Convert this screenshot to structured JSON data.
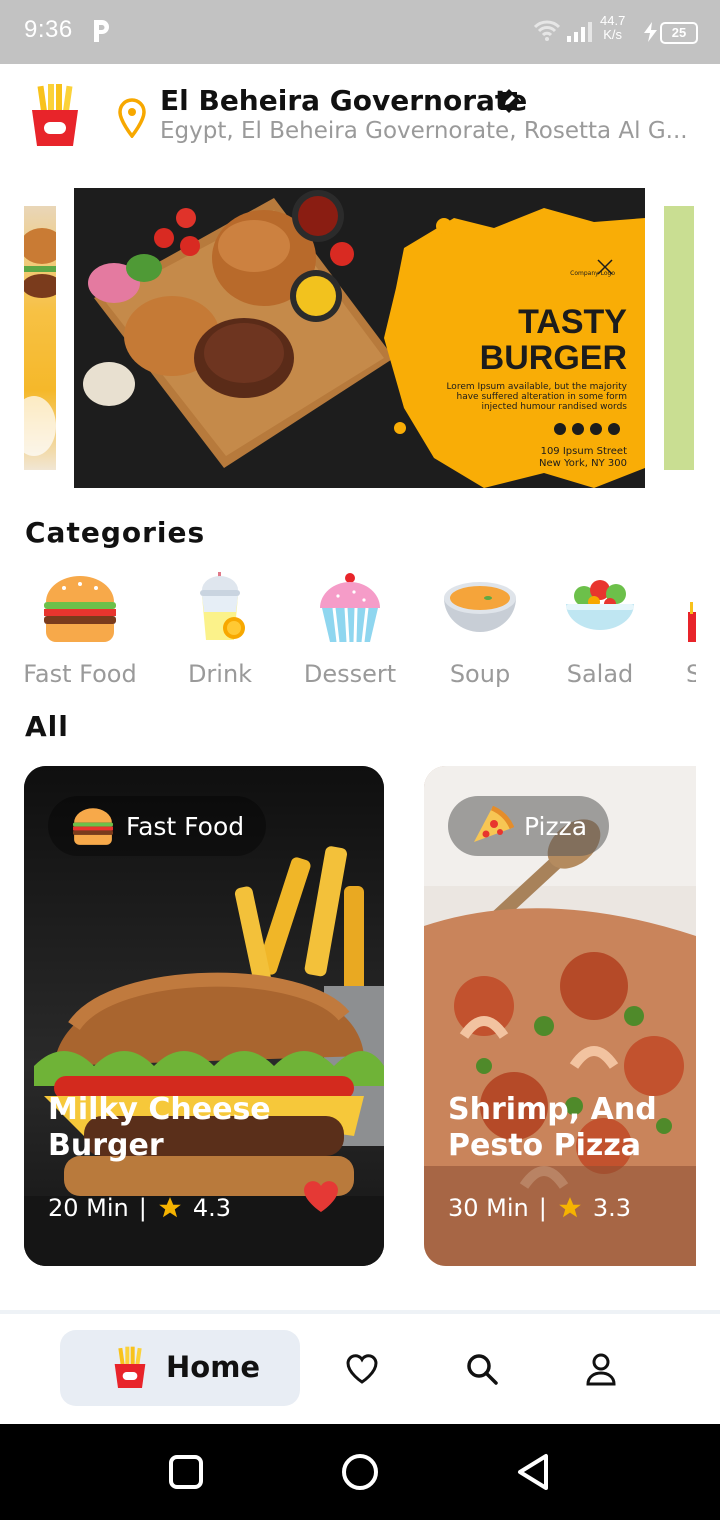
{
  "status_bar": {
    "time": "9:36",
    "net_speed": "44.7",
    "net_unit": "K/s",
    "battery": "25"
  },
  "header": {
    "location_title": "El Beheira Governorate",
    "location_subtitle": "Egypt, El Beheira Governorate, Rosetta Al G..."
  },
  "banner": {
    "headline_line1": "TASTY",
    "headline_line2": "BURGER",
    "company_logo": "Company Logo",
    "body_text": "Lorem Ipsum available, but the majority have suffered alteration in some form injected humour randised words",
    "address_line1": "109 Ipsum Street",
    "address_line2": "New York, NY 300"
  },
  "categories": {
    "title": "Categories",
    "items": [
      {
        "label": "Fast Food",
        "icon": "burger-icon"
      },
      {
        "label": "Drink",
        "icon": "drink-icon"
      },
      {
        "label": "Dessert",
        "icon": "cupcake-icon"
      },
      {
        "label": "Soup",
        "icon": "soup-icon"
      },
      {
        "label": "Salad",
        "icon": "salad-icon"
      },
      {
        "label": "S",
        "icon": "fries-icon"
      }
    ]
  },
  "all": {
    "title": "All",
    "cards": [
      {
        "tag": "Fast Food",
        "title": "Milky Cheese Burger",
        "time": "20 Min",
        "separator": "|",
        "rating": "4.3",
        "favorited": true
      },
      {
        "tag": "Pizza",
        "title": "Shrimp, And Pesto Pizza",
        "time": "30 Min",
        "separator": "|",
        "rating": "3.3",
        "favorited": false
      }
    ]
  },
  "bottom_nav": {
    "home_label": "Home",
    "items": [
      "heart-icon",
      "search-icon",
      "profile-icon"
    ]
  },
  "colors": {
    "accent": "#f7a800",
    "heart": "#e53935",
    "star": "#f5b301",
    "nav_pill": "#e8edf4"
  }
}
